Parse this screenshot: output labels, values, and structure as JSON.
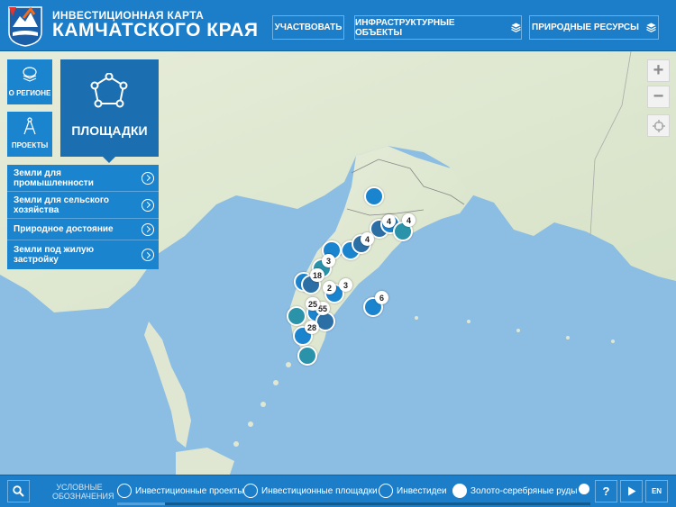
{
  "header": {
    "title_small": "ИНВЕСТИЦИОННАЯ КАРТА",
    "title_big": "КАМЧАТСКОГО КРАЯ",
    "buttons": {
      "participate": "УЧАСТВОВАТЬ",
      "infrastructure": "ИНФРАСТРУКТУРНЫЕ ОБЪЕКТЫ",
      "resources": "ПРИРОДНЫЕ РЕСУРСЫ"
    },
    "layers_icon": "layers-icon"
  },
  "left_panel": {
    "tiles": {
      "region": "О РЕГИОНЕ",
      "projects": "ПРОЕКТЫ",
      "sites": "ПЛОЩАДКИ"
    },
    "menu": [
      "Земли для промышленности",
      "Земли для сельского хозяйства",
      "Природное достояние",
      "Земли под жилую застройку"
    ]
  },
  "map": {
    "zoom_in": "+",
    "zoom_out": "−",
    "locate_icon": "crosshair-icon",
    "cluster_counts": [
      "4",
      "4",
      "4",
      "3",
      "18",
      "2",
      "3",
      "6",
      "55",
      "28",
      "25"
    ],
    "colors": {
      "water": "#8cbde3",
      "land": "#dfe7d2",
      "marker": "#1b84cf",
      "bar": "#1c7ec8"
    }
  },
  "bottom": {
    "legend_title": "УСЛОВНЫЕ ОБОЗНАЧЕНИЯ",
    "legend": [
      "Инвестиционные проекты",
      "Инвестиционные площадки",
      "Инвестидеи",
      "Золото-серебряные руды"
    ],
    "help": "?",
    "lang": "EN",
    "play_icon": "play-icon",
    "search_icon": "search-icon",
    "scroll_position": 0.1
  }
}
